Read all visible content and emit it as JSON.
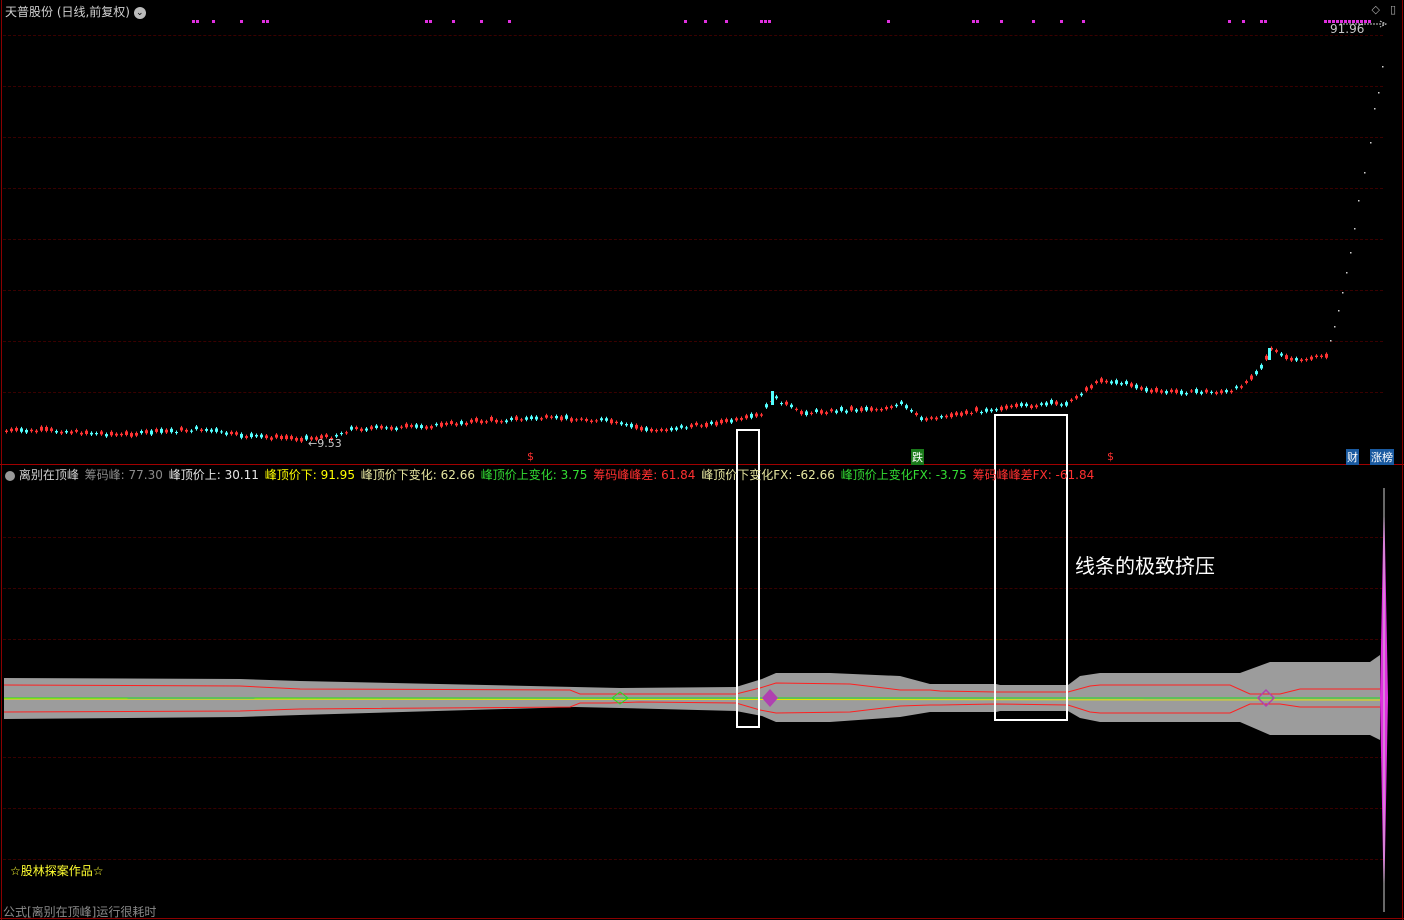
{
  "main_panel": {
    "title": "天普股份 (日线,前复权)",
    "high_label": "91.96",
    "low_label": "←9.53",
    "marker_s": "$",
    "marker_die": "跌",
    "tag_cai": "财",
    "tag_list": "涨榜"
  },
  "indicator_panel": {
    "name": "离别在顶峰",
    "values": [
      {
        "label": "筹码峰: 77.30",
        "color": "#8a8a8a"
      },
      {
        "label": "峰顶价上: 30.11",
        "color": "#e6e6e6"
      },
      {
        "label": "峰顶价下: 91.95",
        "color": "#ffff00"
      },
      {
        "label": "峰顶价下变化: 62.66",
        "color": "#e6e6a0"
      },
      {
        "label": "峰顶价上变化: 3.75",
        "color": "#33dd33"
      },
      {
        "label": "筹码峰峰差: 61.84",
        "color": "#ff3030"
      },
      {
        "label": "峰顶价下变化FX: -62.66",
        "color": "#e6e6a0"
      },
      {
        "label": "峰顶价上变化FX: -3.75",
        "color": "#33dd33"
      },
      {
        "label": "筹码峰峰差FX: -61.84",
        "color": "#ff3030"
      }
    ],
    "annotation": "线条的极致挤压",
    "credit": "☆股林探案作品☆"
  },
  "status_bar": {
    "text": "公式[离别在顶峰]运行很耗时"
  },
  "colors": {
    "up": "#ff3333",
    "down": "#54ffff",
    "band": "#9c9c9c",
    "magenta": "#e030e0",
    "grid": "#3a0000"
  }
}
